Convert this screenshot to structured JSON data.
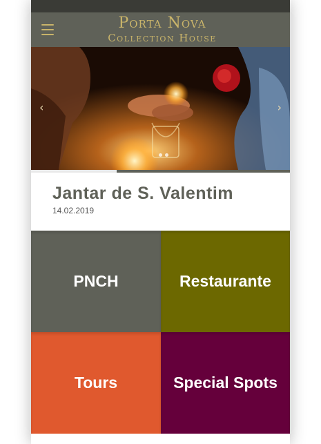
{
  "header": {
    "logo_line1": "Porta Nova",
    "logo_line2": "Collection House",
    "menu_icon": "hamburger-menu-icon",
    "accent_color": "#c9b46a",
    "bar_color": "#5f6158"
  },
  "slider": {
    "prev_icon": "chevron-left-icon",
    "next_icon": "chevron-right-icon",
    "prev_glyph": "‹",
    "next_glyph": "›",
    "dots_count": 2
  },
  "article": {
    "title": "Jantar de S. Valentim",
    "date": "14.02.2019"
  },
  "tiles": [
    {
      "label": "PNCH",
      "color": "#5f6158"
    },
    {
      "label": "Restaurante",
      "color": "#6c6800"
    },
    {
      "label": "Tours",
      "color": "#e0592e"
    },
    {
      "label": "Special Spots",
      "color": "#65003b"
    }
  ]
}
